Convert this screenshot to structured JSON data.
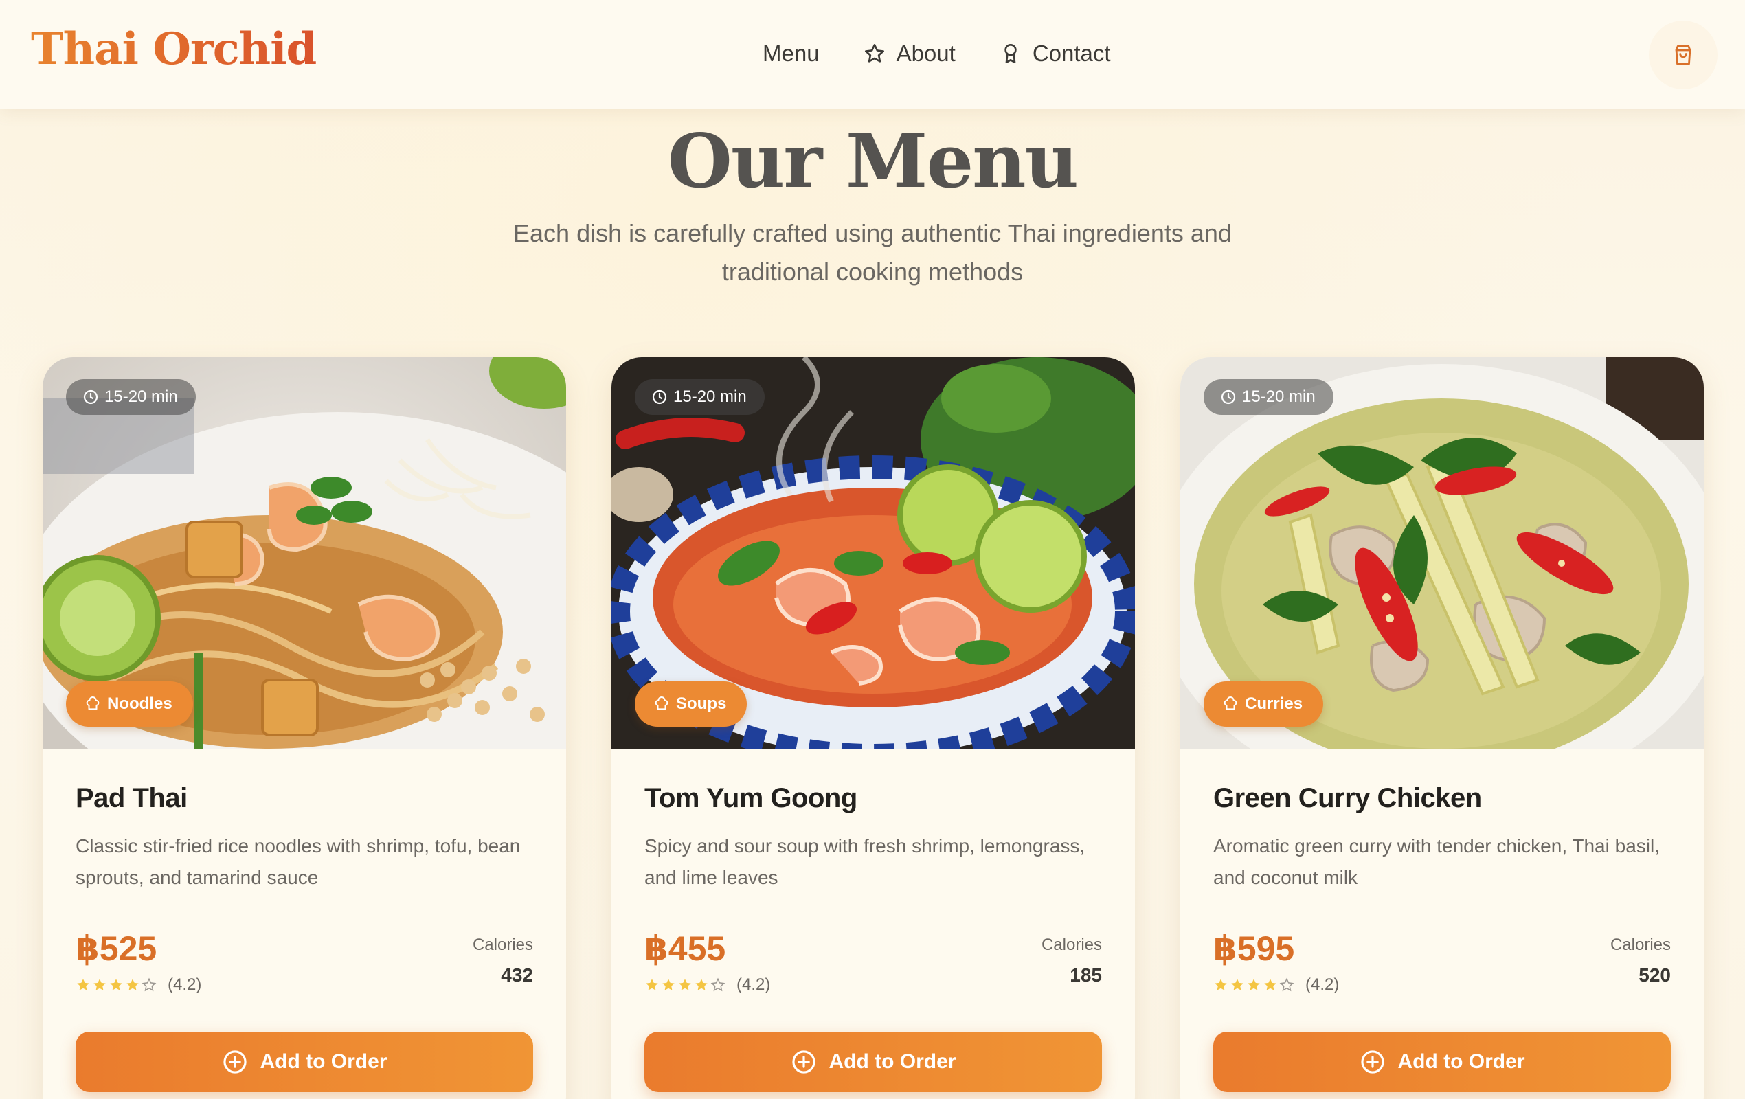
{
  "brand": "Thai Orchid",
  "nav": {
    "menu": "Menu",
    "about": "About",
    "contact": "Contact"
  },
  "hero": {
    "title": "Our Menu",
    "subtitle_line1": "Each dish is carefully crafted using authentic Thai ingredients and",
    "subtitle_line2": "traditional cooking methods"
  },
  "colors": {
    "accent": "#ec8a33",
    "price": "#d96f27",
    "star": "#f4c542"
  },
  "icons": {
    "about": "star-icon",
    "contact": "award-icon",
    "cart": "shopping-bag-icon",
    "time": "clock-icon",
    "category": "chef-hat-icon",
    "add": "plus-circle-icon"
  },
  "cards": [
    {
      "time": "15-20 min",
      "category": "Noodles",
      "name": "Pad Thai",
      "description": "Classic stir-fried rice noodles with shrimp, tofu, bean sprouts, and tamarind sauce",
      "price": "฿525",
      "rating_text": "(4.2)",
      "rating": 4.2,
      "calories_label": "Calories",
      "calories": "432",
      "button": "Add to Order"
    },
    {
      "time": "15-20 min",
      "category": "Soups",
      "name": "Tom Yum Goong",
      "description": "Spicy and sour soup with fresh shrimp, lemongrass, and lime leaves",
      "price": "฿455",
      "rating_text": "(4.2)",
      "rating": 4.2,
      "calories_label": "Calories",
      "calories": "185",
      "button": "Add to Order"
    },
    {
      "time": "15-20 min",
      "category": "Curries",
      "name": "Green Curry Chicken",
      "description": "Aromatic green curry with tender chicken, Thai basil, and coconut milk",
      "price": "฿595",
      "rating_text": "(4.2)",
      "rating": 4.2,
      "calories_label": "Calories",
      "calories": "520",
      "button": "Add to Order"
    }
  ]
}
